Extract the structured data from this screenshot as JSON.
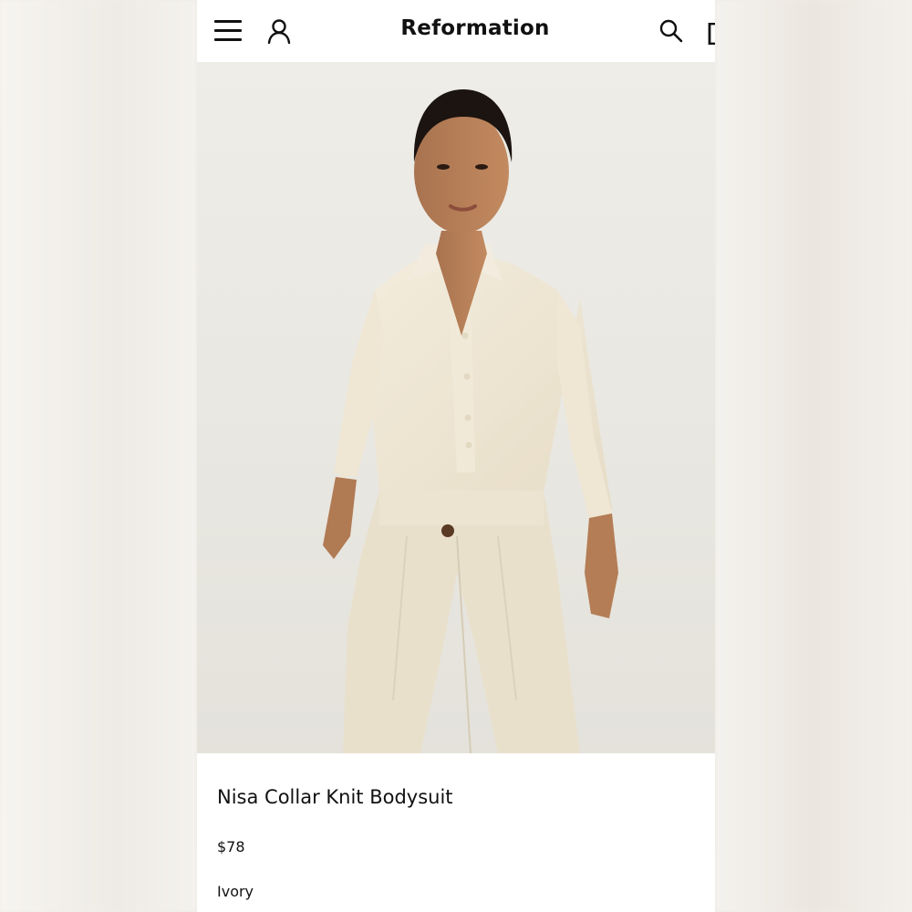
{
  "header": {
    "brand": "Reformation",
    "icons": [
      "menu-icon",
      "account-icon",
      "search-icon",
      "bag-icon"
    ]
  },
  "product": {
    "name": "Nisa Collar Knit Bodysuit",
    "price": "$78",
    "color": "Ivory"
  },
  "colors": {
    "background": "#ffffff",
    "text": "#111111",
    "garment": "#efe7d6"
  }
}
